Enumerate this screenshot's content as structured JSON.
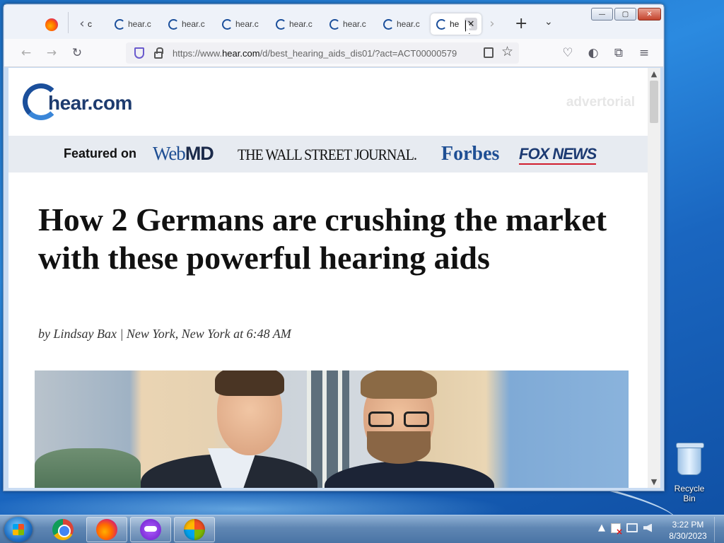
{
  "browser": {
    "tabs": [
      {
        "label": "hear.c"
      },
      {
        "label": "hear.c"
      },
      {
        "label": "hear.c"
      },
      {
        "label": "hear.c"
      },
      {
        "label": "hear.c"
      },
      {
        "label": "hear.c"
      },
      {
        "label": "he",
        "active": true
      }
    ],
    "partial_tab_label": "c",
    "close_tab_symbol": "✕",
    "new_tab_symbol": "+",
    "tab_list_symbol": "⌄",
    "url_prefix": "https://www.",
    "url_domain": "hear.com",
    "url_path": "/d/best_hearing_aids_dis01/?act=ACT00000579",
    "window_buttons": {
      "minimize": "—",
      "maximize": "▢",
      "close": "✕"
    }
  },
  "page": {
    "logo_text": "hear.com",
    "advertorial_label": "advertorial",
    "featured_label": "Featured on",
    "publications": {
      "webmd_prefix": "Web",
      "webmd_suffix": "MD",
      "wsj": "THE WALL STREET JOURNAL.",
      "forbes": "Forbes",
      "fox": "FOX NEWS"
    },
    "headline": "How 2 Germans are crushing the market with these powerful hearing aids",
    "byline": "by Lindsay Bax | New York, New York at 6:48 AM"
  },
  "desktop": {
    "recycle_bin_label": "Recycle Bin"
  },
  "taskbar": {
    "time": "3:22 PM",
    "date": "8/30/2023",
    "tray_arrow": "▲"
  }
}
